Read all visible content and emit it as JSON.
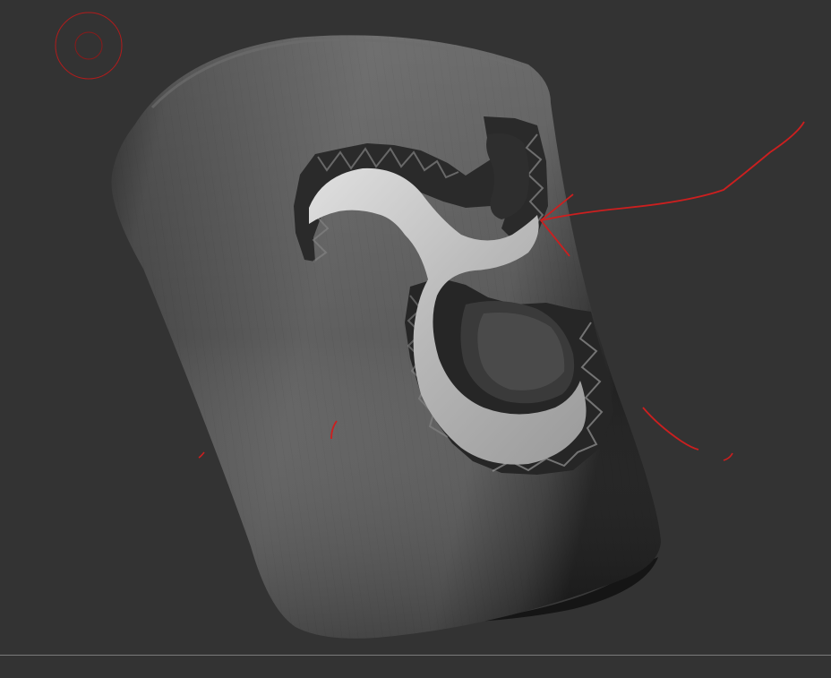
{
  "app": {
    "view": "3d-sculpt-viewport"
  },
  "colors": {
    "background": "#333333",
    "mesh_dark": "#1e1e1e",
    "mesh_mid": "#5a5a5a",
    "mesh_light": "#8a8a8a",
    "cutout_light": "#d2d2d2",
    "annotation_red": "#cc1f1f",
    "divider": "#7a7a7a"
  },
  "icons": {
    "brush_cursor": "brush-cursor-icon"
  },
  "annotations": {
    "arrow_pointing_to": "cutout-inner-edge"
  }
}
